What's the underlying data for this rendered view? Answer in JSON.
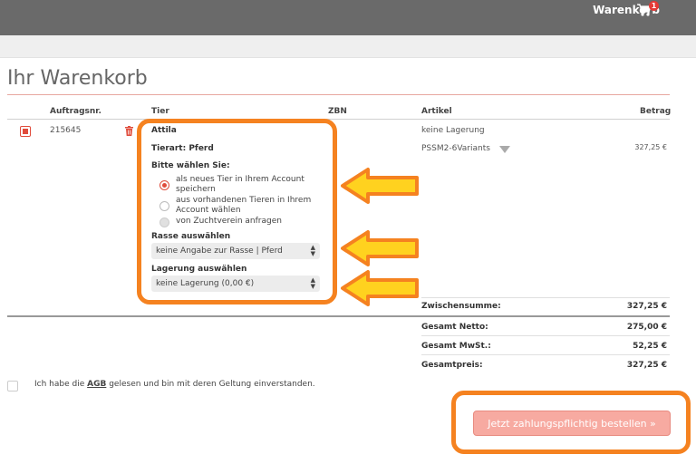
{
  "header": {
    "cart_label": "Warenkorb",
    "cart_count": "1"
  },
  "page": {
    "title": "Ihr Warenkorb"
  },
  "table": {
    "columns": [
      "Auftragsnr.",
      "Tier",
      "ZBN",
      "Artikel",
      "Betrag"
    ],
    "row": {
      "order_no": "215645",
      "animal_name": "Attila",
      "animal_type": "Tierart: Pferd",
      "choose_label": "Bitte wählen Sie:",
      "options": [
        "als neues Tier in Ihrem Account speichern",
        "aus vorhandenen Tieren in Ihrem Account wählen",
        "von Zuchtverein anfragen"
      ],
      "breed_label": "Rasse auswählen",
      "breed_value": "keine Angabe zur Rasse | Pferd",
      "storage_label": "Lagerung auswählen",
      "storage_value": "keine Lagerung (0,00 €)",
      "article_line1": "keine Lagerung",
      "article_line2": "PSSM2-6Variants",
      "amount": "327,25 €"
    }
  },
  "summary": {
    "subtotal_label": "Zwischensumme:",
    "subtotal_value": "327,25 €",
    "net_label": "Gesamt Netto:",
    "net_value": "275,00 €",
    "vat_label": "Gesamt MwSt.:",
    "vat_value": "52,25 €",
    "total_label": "Gesamtpreis:",
    "total_value": "327,25 €"
  },
  "agb": {
    "prefix": "Ich habe die",
    "link": "AGB",
    "suffix": "gelesen und bin mit deren Geltung einverstanden."
  },
  "order_button": "Jetzt zahlungspflichtig bestellen »",
  "colors": {
    "accent": "#e04c3c",
    "highlight": "#f58220",
    "arrow_fill": "#ffd21f",
    "button": "#f7aaa1"
  },
  "icons": [
    "cart-icon",
    "trash-icon",
    "caret-down-icon",
    "select-arrows-icon",
    "arrow-left-icon"
  ]
}
